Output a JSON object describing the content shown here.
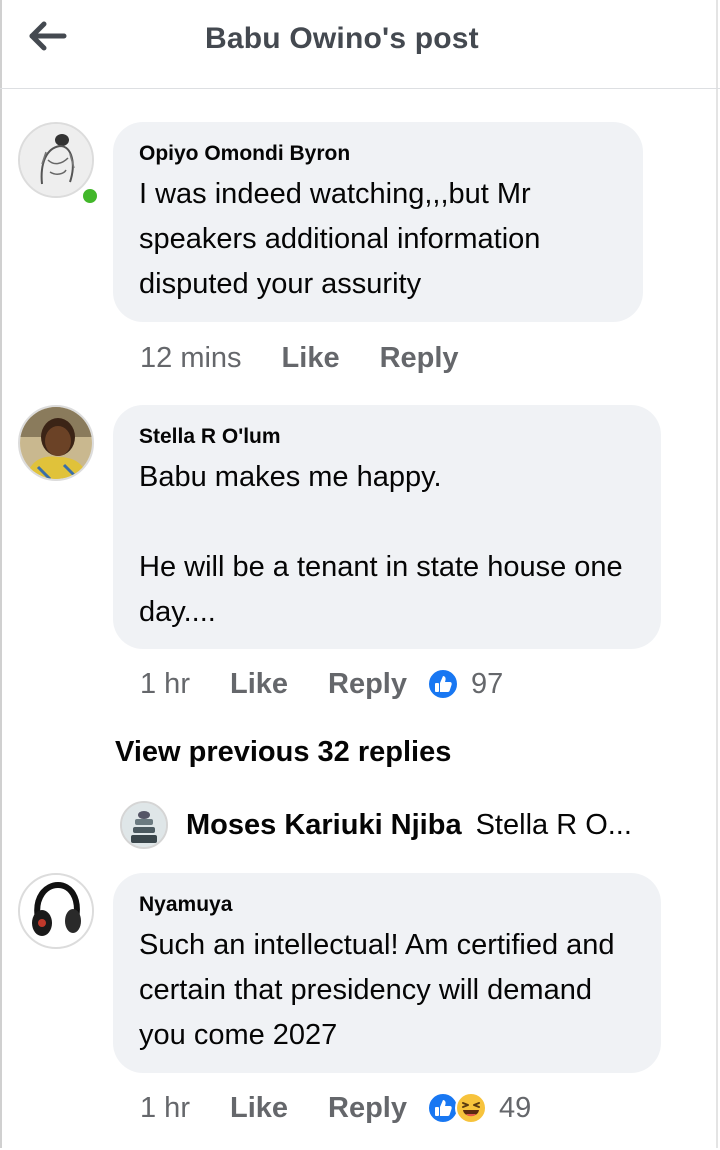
{
  "header": {
    "title": "Babu Owino's post",
    "back_icon": "arrow-left-icon"
  },
  "comments": [
    {
      "author": "Opiyo Omondi Byron",
      "text": "I was indeed watching,,,but Mr speakers additional information disputed your assurity",
      "time": "12 mins",
      "like_label": "Like",
      "reply_label": "Reply",
      "online": true
    },
    {
      "author": "Stella R O'lum",
      "text": "Babu makes me happy.\n\nHe will be a tenant in state house one day....",
      "time": "1 hr",
      "like_label": "Like",
      "reply_label": "Reply",
      "reactions": [
        "like-reaction-icon"
      ],
      "reaction_count": "97"
    },
    {
      "author": "Nyamuya",
      "text": "Such an intellectual! Am certified and certain that presidency will demand you come 2027",
      "time": "1 hr",
      "like_label": "Like",
      "reply_label": "Reply",
      "reactions": [
        "like-reaction-icon",
        "haha-reaction-icon"
      ],
      "reaction_count": "49"
    }
  ],
  "replies": {
    "view_previous_label": "View previous 32 replies",
    "latest_author": "Moses Kariuki Njiba",
    "latest_snippet": "Stella R O..."
  },
  "colors": {
    "bubble": "#f0f2f5",
    "meta_text": "#65676b",
    "like_blue": "#1877f2",
    "online_green": "#42b72a"
  }
}
